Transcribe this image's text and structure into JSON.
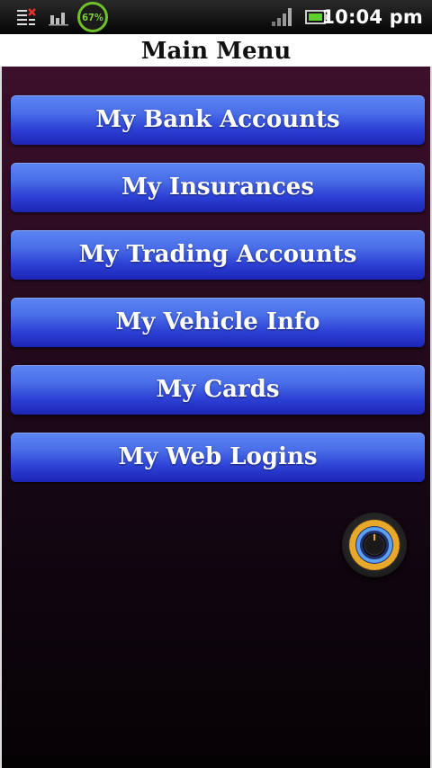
{
  "status_bar": {
    "battery_percent": "67%",
    "time": "10:04 pm",
    "icons": [
      "notification-list-icon",
      "bar-chart-icon",
      "battery-circle-icon",
      "signal-strength-icon",
      "battery-icon"
    ]
  },
  "title": "Main Menu",
  "menu": [
    {
      "label": "My Bank Accounts"
    },
    {
      "label": "My Insurances"
    },
    {
      "label": "My Trading Accounts"
    },
    {
      "label": "My Vehicle Info"
    },
    {
      "label": "My Cards"
    },
    {
      "label": "My Web Logins"
    }
  ],
  "colors": {
    "button_top": "#5c86f4",
    "button_bottom": "#1c25b5",
    "background_top": "#3d0f2c",
    "background_bottom": "#050204",
    "battery_ring": "#6fc12a",
    "knob_accent": "#e8a82a"
  }
}
